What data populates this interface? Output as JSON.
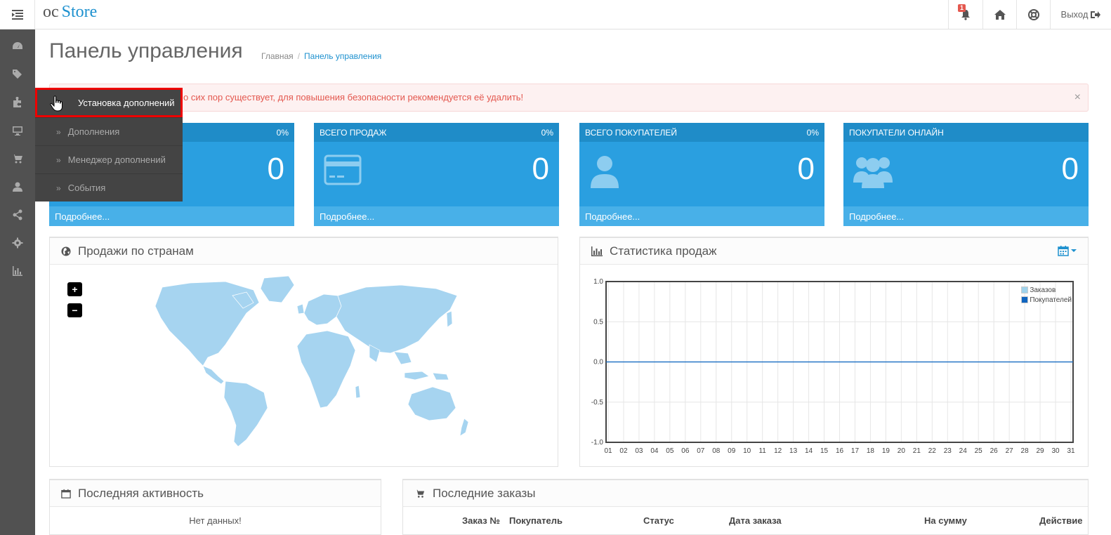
{
  "header": {
    "logo_prefix": "oc",
    "logo_name": "Store",
    "notification_count": "1",
    "logout_label": "Выход"
  },
  "flyout": {
    "title": "Установка дополнений",
    "items": [
      "Дополнения",
      "Менеджер дополнений",
      "События"
    ]
  },
  "page": {
    "title": "Панель управления",
    "breadcrumb": [
      "Главная",
      "Панель управления"
    ]
  },
  "alert": {
    "text": "о сих пор существует, для повышения безопасности рекомендуется её удалить!",
    "close": "×"
  },
  "tiles": [
    {
      "title": "",
      "percent": "0%",
      "value": "0",
      "more": "Подробнее..."
    },
    {
      "title": "ВСЕГО ПРОДАЖ",
      "percent": "0%",
      "value": "0",
      "more": "Подробнее..."
    },
    {
      "title": "ВСЕГО ПОКУПАТЕЛЕЙ",
      "percent": "0%",
      "value": "0",
      "more": "Подробнее..."
    },
    {
      "title": "ПОКУПАТЕЛИ ОНЛАЙН",
      "percent": "",
      "value": "0",
      "more": "Подробнее..."
    }
  ],
  "map_panel": {
    "title": "Продажи по странам",
    "zoom_in": "+",
    "zoom_out": "−"
  },
  "stats_panel": {
    "title": "Статистика продаж"
  },
  "chart_data": {
    "type": "line",
    "x": [
      "01",
      "02",
      "03",
      "04",
      "05",
      "06",
      "07",
      "08",
      "09",
      "10",
      "11",
      "12",
      "13",
      "14",
      "15",
      "16",
      "17",
      "18",
      "19",
      "20",
      "21",
      "22",
      "23",
      "24",
      "25",
      "26",
      "27",
      "28",
      "29",
      "30",
      "31"
    ],
    "series": [
      {
        "name": "Заказов",
        "values": [
          0,
          0,
          0,
          0,
          0,
          0,
          0,
          0,
          0,
          0,
          0,
          0,
          0,
          0,
          0,
          0,
          0,
          0,
          0,
          0,
          0,
          0,
          0,
          0,
          0,
          0,
          0,
          0,
          0,
          0,
          0
        ],
        "color": "#9fd3ec"
      },
      {
        "name": "Покупателей",
        "values": [
          0,
          0,
          0,
          0,
          0,
          0,
          0,
          0,
          0,
          0,
          0,
          0,
          0,
          0,
          0,
          0,
          0,
          0,
          0,
          0,
          0,
          0,
          0,
          0,
          0,
          0,
          0,
          0,
          0,
          0,
          0
        ],
        "color": "#1065c0"
      }
    ],
    "yticks": [
      "1.0",
      "0.5",
      "0.0",
      "-0.5",
      "-1.0"
    ],
    "ylim": [
      -1.0,
      1.0
    ],
    "grid": true,
    "legend": "top-right"
  },
  "activity_panel": {
    "title": "Последняя активность",
    "empty": "Нет данных!"
  },
  "orders_panel": {
    "title": "Последние заказы",
    "columns": [
      "Заказ №",
      "Покупатель",
      "Статус",
      "Дата заказа",
      "На сумму",
      "Действие"
    ]
  },
  "colors": {
    "accent": "#1e91cf",
    "tile": "#2a9fe0",
    "alert": "#e4584f",
    "sidebar": "#515151"
  }
}
